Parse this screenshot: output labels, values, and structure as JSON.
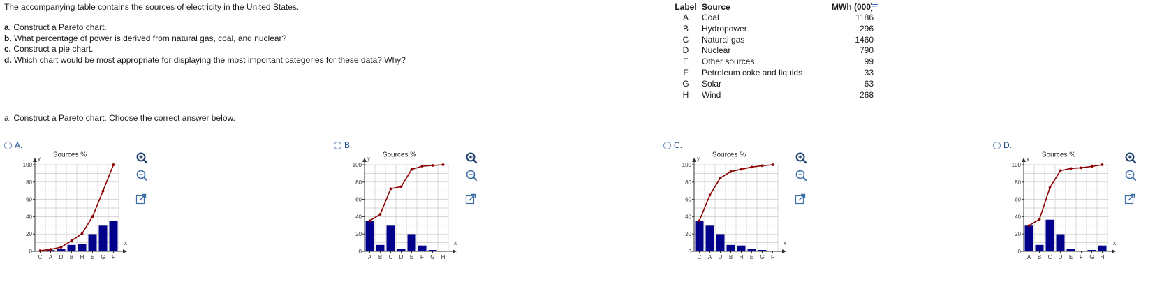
{
  "question": {
    "intro": "The accompanying table contains the sources of electricity in the United States.",
    "items": [
      {
        "letter": "a.",
        "text": " Construct a Pareto chart."
      },
      {
        "letter": "b.",
        "text": " What percentage of power is derived from natural gas, coal, and nuclear?"
      },
      {
        "letter": "c.",
        "text": " Construct a pie chart."
      },
      {
        "letter": "d.",
        "text": " Which chart would be most appropriate for displaying the most important categories for these data? Why?"
      }
    ]
  },
  "table": {
    "headers": {
      "label": "Label",
      "source": "Source",
      "mwh": "MWh (000)"
    },
    "rows": [
      {
        "label": "A",
        "source": "Coal",
        "mwh": "1186"
      },
      {
        "label": "B",
        "source": "Hydropower",
        "mwh": "296"
      },
      {
        "label": "C",
        "source": "Natural gas",
        "mwh": "1460"
      },
      {
        "label": "D",
        "source": "Nuclear",
        "mwh": "790"
      },
      {
        "label": "E",
        "source": "Other sources",
        "mwh": "99"
      },
      {
        "label": "F",
        "source": "Petroleum coke and liquids",
        "mwh": "33"
      },
      {
        "label": "G",
        "source": "Solar",
        "mwh": "63"
      },
      {
        "label": "H",
        "source": "Wind",
        "mwh": "268"
      }
    ]
  },
  "part_a": {
    "prompt": "a. Construct a Pareto chart. Choose the correct answer below."
  },
  "colors": {
    "bar": "#00008b",
    "line": "#8b0000",
    "grid": "#c8c8c8",
    "radio": "#6a8fb5"
  },
  "icons": [
    "zoom-in-icon",
    "zoom-out-icon",
    "open-external-icon",
    "copy-icon"
  ],
  "options": [
    {
      "letter": "A.",
      "selected": false
    },
    {
      "letter": "B.",
      "selected": false
    },
    {
      "letter": "C.",
      "selected": false
    },
    {
      "letter": "D.",
      "selected": false
    }
  ],
  "chart_data": [
    {
      "type": "bar",
      "option": "A.",
      "title": "Sources %",
      "xlabel": "x",
      "ylabel": "y",
      "ylim": [
        0,
        100
      ],
      "yticks": [
        "0",
        "20",
        "40",
        "60",
        "80",
        "100"
      ],
      "categories": [
        "C",
        "A",
        "D",
        "B",
        "H",
        "E",
        "G",
        "F"
      ],
      "series": [
        {
          "values": [
            0.8,
            1.5,
            2.5,
            7.4,
            8.1,
            19.8,
            29.6,
            35.3
          ]
        },
        {
          "values": [
            0.8,
            2.3,
            4.8,
            12.2,
            20.3,
            40.1,
            69.7,
            100
          ]
        }
      ],
      "grid": true
    },
    {
      "type": "bar",
      "option": "B.",
      "title": "Sources %",
      "xlabel": "x",
      "ylabel": "y",
      "ylim": [
        0,
        100
      ],
      "yticks": [
        "0",
        "20",
        "40",
        "60",
        "80",
        "100"
      ],
      "categories": [
        "A",
        "B",
        "C",
        "D",
        "E",
        "F",
        "G",
        "H"
      ],
      "series": [
        {
          "values": [
            35.3,
            7.4,
            29.6,
            2.5,
            19.8,
            6.7,
            1.6,
            0.8
          ]
        },
        {
          "values": [
            35.3,
            42.7,
            72.3,
            74.8,
            94.6,
            98.3,
            99.2,
            100
          ]
        }
      ],
      "grid": true
    },
    {
      "type": "bar",
      "option": "C.",
      "title": "Sources %",
      "xlabel": "x",
      "ylabel": "y",
      "ylim": [
        0,
        100
      ],
      "yticks": [
        "0",
        "20",
        "40",
        "60",
        "80",
        "100"
      ],
      "categories": [
        "C",
        "A",
        "D",
        "B",
        "H",
        "E",
        "G",
        "F"
      ],
      "series": [
        {
          "values": [
            35.3,
            29.6,
            19.8,
            7.4,
            6.7,
            2.5,
            1.6,
            0.8
          ]
        },
        {
          "values": [
            35.3,
            64.9,
            84.7,
            92.1,
            94.8,
            97.3,
            98.9,
            100
          ]
        }
      ],
      "grid": true
    },
    {
      "type": "bar",
      "option": "D.",
      "title": "Sources %",
      "xlabel": "x",
      "ylabel": "y",
      "ylim": [
        0,
        100
      ],
      "yticks": [
        "0",
        "20",
        "40",
        "60",
        "80",
        "100"
      ],
      "categories": [
        "A",
        "B",
        "C",
        "D",
        "E",
        "F",
        "G",
        "H"
      ],
      "series": [
        {
          "values": [
            29.6,
            7.4,
            36.5,
            19.7,
            2.5,
            0.8,
            1.6,
            6.7
          ]
        },
        {
          "values": [
            29.6,
            37.0,
            73.5,
            93.2,
            95.7,
            96.5,
            98.1,
            100
          ]
        }
      ],
      "grid": true
    }
  ]
}
